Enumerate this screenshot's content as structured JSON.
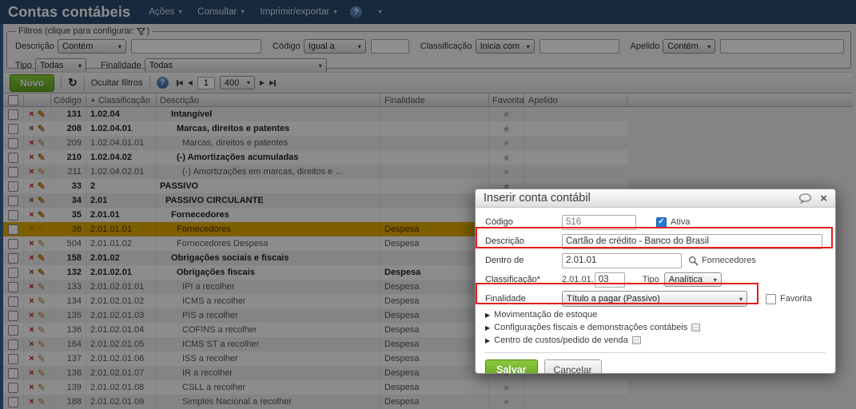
{
  "icons": {
    "caret": "▾",
    "menu_caret": "▼",
    "sort_asc": "▲",
    "expand": "▶",
    "prev": "◀",
    "next": "▶",
    "refresh": "↻",
    "close": "×",
    "help": "?",
    "star": "★",
    "delete": "×",
    "pencil": "✎",
    "check": "✓"
  },
  "colors": {
    "appbar": "#24466b",
    "accent_green": "#64a71e",
    "highlight_row": "#dfa900",
    "annotation_red": "#e31b1b",
    "ativa_checkbox_blue": "#1f7bd4"
  },
  "header": {
    "title": "Contas contábeis",
    "menus": [
      {
        "label": "Ações"
      },
      {
        "label": "Consultar"
      },
      {
        "label": "Imprimir/exportar"
      }
    ]
  },
  "filters": {
    "legend_prefix": "Filtros (clique para configurar:",
    "legend_suffix": ")",
    "descricao": {
      "label": "Descrição",
      "op": "Contém",
      "value": ""
    },
    "codigo": {
      "label": "Código",
      "op": "Igual a",
      "value": ""
    },
    "classificacao": {
      "label": "Classificação",
      "op": "Inicia com",
      "value": ""
    },
    "apelido": {
      "label": "Apelido",
      "op": "Contém",
      "value": ""
    },
    "tipo": {
      "label": "Tipo",
      "value": "Todas"
    },
    "finalidade": {
      "label": "Finalidade",
      "value": "Todas"
    }
  },
  "toolbar": {
    "novo_label": "Novo",
    "ocultar_label": "Ocultar filtros",
    "page_value": "1",
    "page_size": "400"
  },
  "table": {
    "headers": {
      "codigo": "Código",
      "classificacao": "Classificação",
      "descricao": "Descrição",
      "finalidade": "Finalidade",
      "favorita": "Favorita",
      "apelido": "Apelido"
    },
    "rows": [
      {
        "code": "131",
        "cls": "1.02.04",
        "desc": "Intangível",
        "fin": "",
        "bold": true,
        "fin_bold": false,
        "depth": 3,
        "highlight": false
      },
      {
        "code": "208",
        "cls": "1.02.04.01",
        "desc": "Marcas, direitos e patentes",
        "fin": "",
        "bold": true,
        "fin_bold": false,
        "depth": 4,
        "highlight": false
      },
      {
        "code": "209",
        "cls": "1.02.04.01.01",
        "desc": "Marcas, direitos e patentes",
        "fin": "",
        "bold": false,
        "fin_bold": false,
        "depth": 5,
        "highlight": false
      },
      {
        "code": "210",
        "cls": "1.02.04.02",
        "desc": "(-) Amortizações acumuladas",
        "fin": "",
        "bold": true,
        "fin_bold": false,
        "depth": 4,
        "highlight": false
      },
      {
        "code": "211",
        "cls": "1.02.04.02.01",
        "desc": "(-) Amortizações em marcas, direitos e ...",
        "fin": "",
        "bold": false,
        "fin_bold": false,
        "depth": 5,
        "highlight": false
      },
      {
        "code": "33",
        "cls": "2",
        "desc": "PASSIVO",
        "fin": "",
        "bold": true,
        "fin_bold": false,
        "depth": 1,
        "highlight": false
      },
      {
        "code": "34",
        "cls": "2.01",
        "desc": "PASSIVO CIRCULANTE",
        "fin": "",
        "bold": true,
        "fin_bold": false,
        "depth": 2,
        "highlight": false
      },
      {
        "code": "35",
        "cls": "2.01.01",
        "desc": "Fornecedores",
        "fin": "",
        "bold": true,
        "fin_bold": false,
        "depth": 3,
        "highlight": false
      },
      {
        "code": "36",
        "cls": "2.01.01.01",
        "desc": "Fornecedores",
        "fin": "Despesa",
        "bold": false,
        "fin_bold": false,
        "depth": 4,
        "highlight": true
      },
      {
        "code": "504",
        "cls": "2.01.01.02",
        "desc": "Fornecedores Despesa",
        "fin": "Despesa",
        "bold": false,
        "fin_bold": false,
        "depth": 4,
        "highlight": false
      },
      {
        "code": "158",
        "cls": "2.01.02",
        "desc": "Obrigações sociais e fiscais",
        "fin": "",
        "bold": true,
        "fin_bold": false,
        "depth": 3,
        "highlight": false
      },
      {
        "code": "132",
        "cls": "2.01.02.01",
        "desc": "Obrigações fiscais",
        "fin": "Despesa",
        "bold": true,
        "fin_bold": true,
        "depth": 4,
        "highlight": false
      },
      {
        "code": "133",
        "cls": "2.01.02.01.01",
        "desc": "IPI a recolher",
        "fin": "Despesa",
        "bold": false,
        "fin_bold": false,
        "depth": 5,
        "highlight": false
      },
      {
        "code": "134",
        "cls": "2.01.02.01.02",
        "desc": "ICMS a recolher",
        "fin": "Despesa",
        "bold": false,
        "fin_bold": false,
        "depth": 5,
        "highlight": false
      },
      {
        "code": "135",
        "cls": "2.01.02.01.03",
        "desc": "PIS a recolher",
        "fin": "Despesa",
        "bold": false,
        "fin_bold": false,
        "depth": 5,
        "highlight": false
      },
      {
        "code": "136",
        "cls": "2.01.02.01.04",
        "desc": "COFINS a recolher",
        "fin": "Despesa",
        "bold": false,
        "fin_bold": false,
        "depth": 5,
        "highlight": false
      },
      {
        "code": "164",
        "cls": "2.01.02.01.05",
        "desc": "ICMS ST a recolher",
        "fin": "Despesa",
        "bold": false,
        "fin_bold": false,
        "depth": 5,
        "highlight": false
      },
      {
        "code": "137",
        "cls": "2.01.02.01.06",
        "desc": "ISS a recolher",
        "fin": "Despesa",
        "bold": false,
        "fin_bold": false,
        "depth": 5,
        "highlight": false
      },
      {
        "code": "138",
        "cls": "2.01.02.01.07",
        "desc": "IR a recolher",
        "fin": "Despesa",
        "bold": false,
        "fin_bold": false,
        "depth": 5,
        "highlight": false
      },
      {
        "code": "139",
        "cls": "2.01.02.01.08",
        "desc": "CSLL a recolher",
        "fin": "Despesa",
        "bold": false,
        "fin_bold": false,
        "depth": 5,
        "highlight": false
      },
      {
        "code": "188",
        "cls": "2.01.02.01.09",
        "desc": "Simples Nacional a recolher",
        "fin": "Despesa",
        "bold": false,
        "fin_bold": false,
        "depth": 5,
        "highlight": false
      }
    ]
  },
  "modal": {
    "title": "Inserir conta contábil",
    "codigo": {
      "label": "Código",
      "value": "516"
    },
    "ativa": {
      "label": "Ativa",
      "checked": true
    },
    "descricao": {
      "label": "Descrição",
      "value": "Cartão de crédito - Banco do Brasil"
    },
    "dentro_de": {
      "label": "Dentro de",
      "value": "2.01.01",
      "ref": "Fornecedores"
    },
    "classificacao": {
      "label": "Classificação*",
      "prefix": "2.01.01.",
      "value": "03"
    },
    "tipo": {
      "label": "Tipo",
      "value": "Analítica"
    },
    "finalidade": {
      "label": "Finalidade",
      "value": "Título a pagar (Passivo)"
    },
    "favorita": {
      "label": "Favorita",
      "checked": false
    },
    "sections": [
      {
        "label": "Movimentação de estoque",
        "icon": false
      },
      {
        "label": "Configurações fiscais e demonstrações contábeis",
        "icon": true
      },
      {
        "label": "Centro de custos/pedido de venda",
        "icon": true
      }
    ],
    "salvar_label": "Salvar",
    "cancelar_label": "Cancelar"
  }
}
